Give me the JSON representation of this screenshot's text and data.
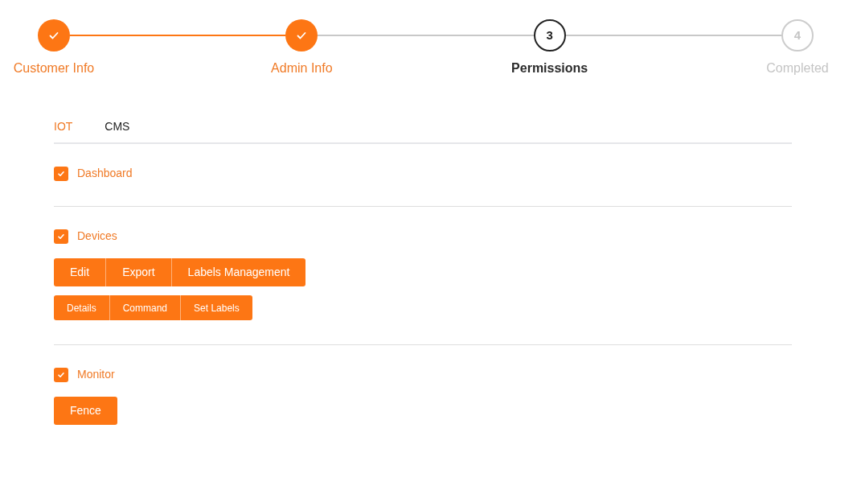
{
  "steps": [
    {
      "label": "Customer Info",
      "kind": "done"
    },
    {
      "label": "Admin Info",
      "kind": "done"
    },
    {
      "label": "Permissions",
      "number": "3",
      "kind": "current"
    },
    {
      "label": "Completed",
      "number": "4",
      "kind": "pending"
    }
  ],
  "tabs": [
    {
      "label": "IOT",
      "selected": true
    },
    {
      "label": "CMS",
      "selected": false
    }
  ],
  "sections": [
    {
      "label": "Dashboard",
      "checked": true
    },
    {
      "label": "Devices",
      "checked": true,
      "button_groups": [
        {
          "kind": "large",
          "buttons": [
            {
              "label": "Edit",
              "selected": true
            },
            {
              "label": "Export",
              "selected": true
            },
            {
              "label": "Labels Management",
              "selected": true
            }
          ]
        },
        {
          "kind": "small",
          "buttons": [
            {
              "label": "Details",
              "selected": true
            },
            {
              "label": "Command",
              "selected": true
            },
            {
              "label": "Set Labels",
              "selected": true
            }
          ]
        }
      ]
    },
    {
      "label": "Monitor",
      "checked": true,
      "button_groups": [
        {
          "kind": "large",
          "buttons": [
            {
              "label": "Fence",
              "selected": true
            }
          ]
        }
      ]
    }
  ]
}
